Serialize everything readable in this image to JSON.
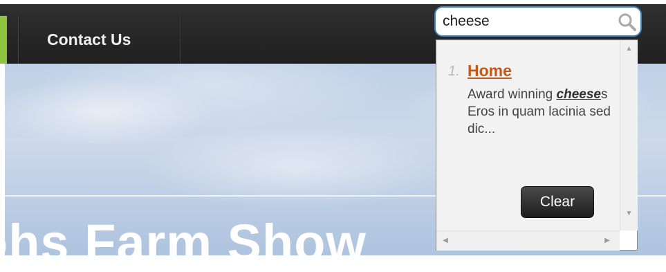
{
  "nav": {
    "items": [
      {
        "label": "Contact Us"
      }
    ]
  },
  "banner": {
    "title": "ohs Farm Show"
  },
  "search": {
    "value": "cheese"
  },
  "results": {
    "items": [
      {
        "number": "1.",
        "title": "Home",
        "snippet_before": "Award winning ",
        "highlight": "cheese",
        "snippet_after": "s Eros in quam lacinia sed dic..."
      }
    ],
    "clear_label": "Clear"
  },
  "colors": {
    "nav_background": "#2a2a2a",
    "nav_accent": "#8fc43f",
    "search_border": "#3d86c2",
    "result_link": "#c05a1a",
    "clear_button": "#2e2e2e"
  },
  "icons": {
    "search": "magnifier-icon",
    "scroll_up": "triangle-up-icon",
    "scroll_down": "triangle-down-icon",
    "scroll_left": "triangle-left-icon",
    "scroll_right": "triangle-right-icon"
  }
}
